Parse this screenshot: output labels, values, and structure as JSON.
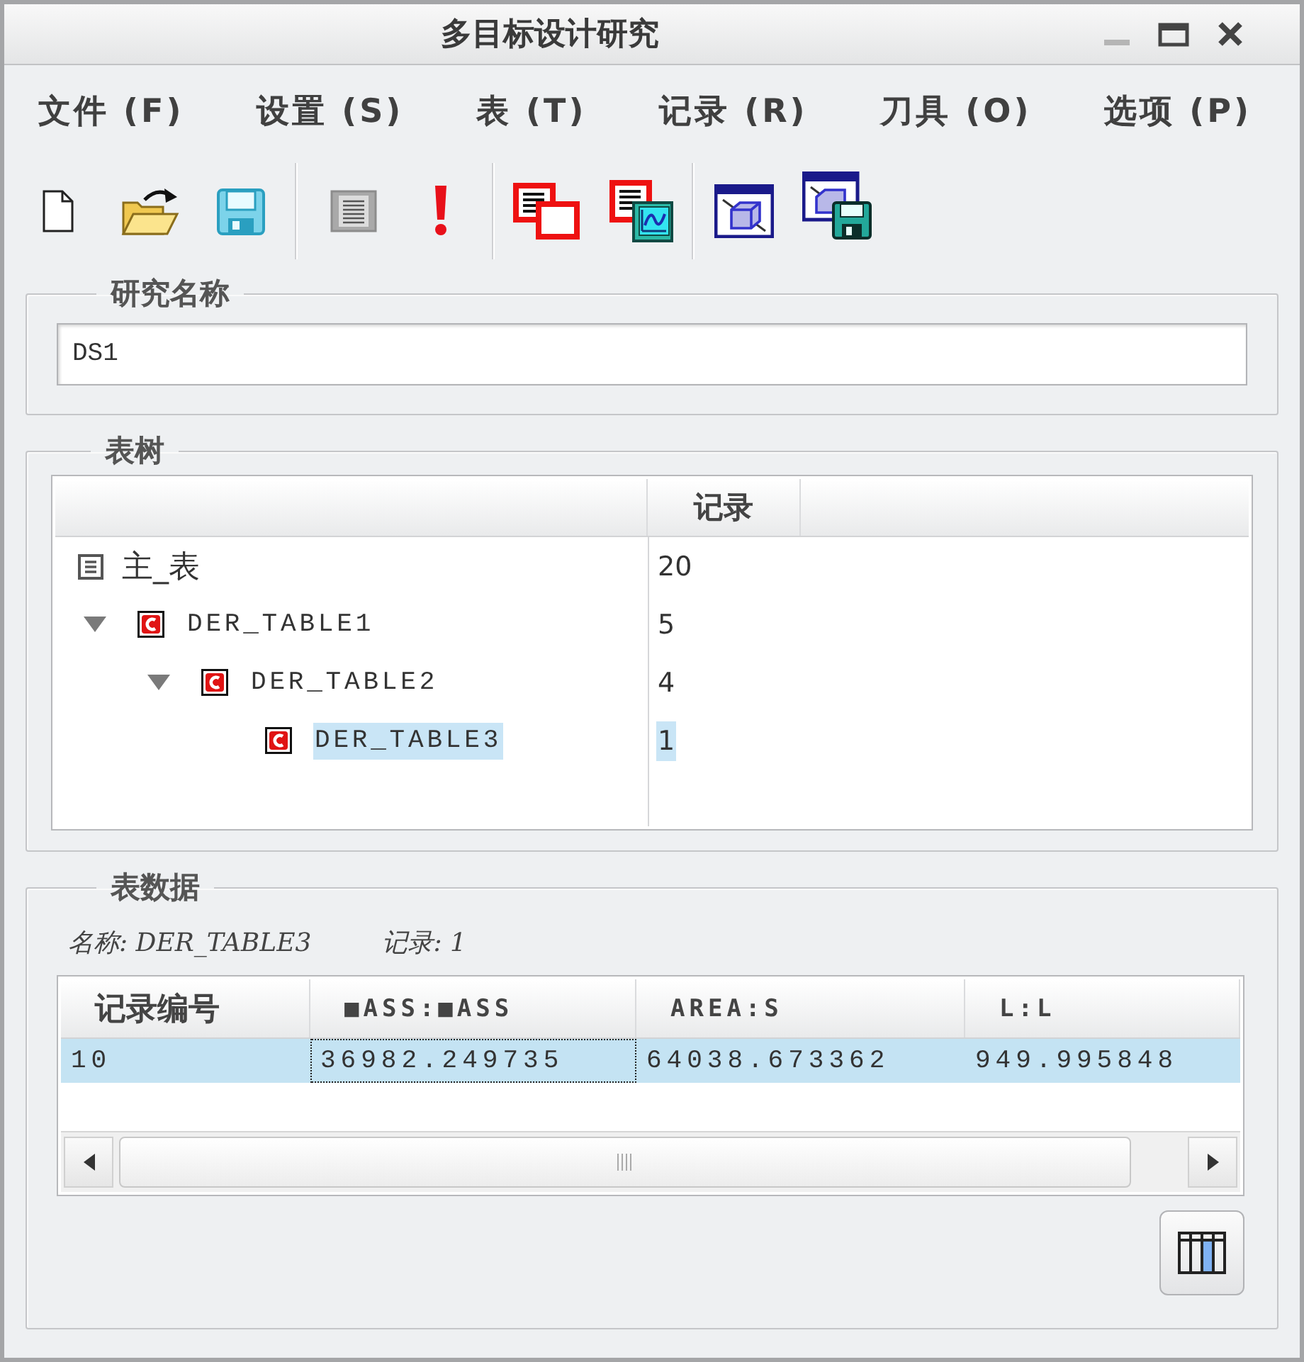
{
  "window": {
    "title": "多目标设计研究"
  },
  "menu": [
    "文件 (F)",
    "设置 (S)",
    "表 (T)",
    "记录 (R)",
    "刀具 (O)",
    "选项 (P)"
  ],
  "study_name": {
    "label": "研究名称",
    "value": "DS1"
  },
  "table_tree": {
    "label": "表树",
    "columns": [
      "记录"
    ],
    "rows": [
      {
        "kind": "master",
        "name": "主_表",
        "records": "20",
        "selected": false
      },
      {
        "kind": "derived",
        "name": "DER_TABLE1",
        "records": "5",
        "selected": false,
        "expanded": true,
        "children": [
          {
            "kind": "derived",
            "name": "DER_TABLE2",
            "records": "4",
            "selected": false,
            "expanded": true,
            "children": [
              {
                "kind": "derived",
                "name": "DER_TABLE3",
                "records": "1",
                "selected": true
              }
            ]
          }
        ]
      }
    ]
  },
  "table_data": {
    "label": "表数据",
    "info": [
      "名称: DER_TABLE3",
      "记录: 1"
    ],
    "columns": [
      "记录编号",
      "■ASS:■ASS",
      "AREA:S",
      "L:L"
    ],
    "rows": [
      {
        "selected": true,
        "cells": [
          {
            "text": "10",
            "focused": false
          },
          {
            "text": "36982.249735",
            "focused": true
          },
          {
            "text": "64038.673362",
            "focused": false
          },
          {
            "text": "949.995848",
            "focused": false
          }
        ]
      }
    ]
  }
}
